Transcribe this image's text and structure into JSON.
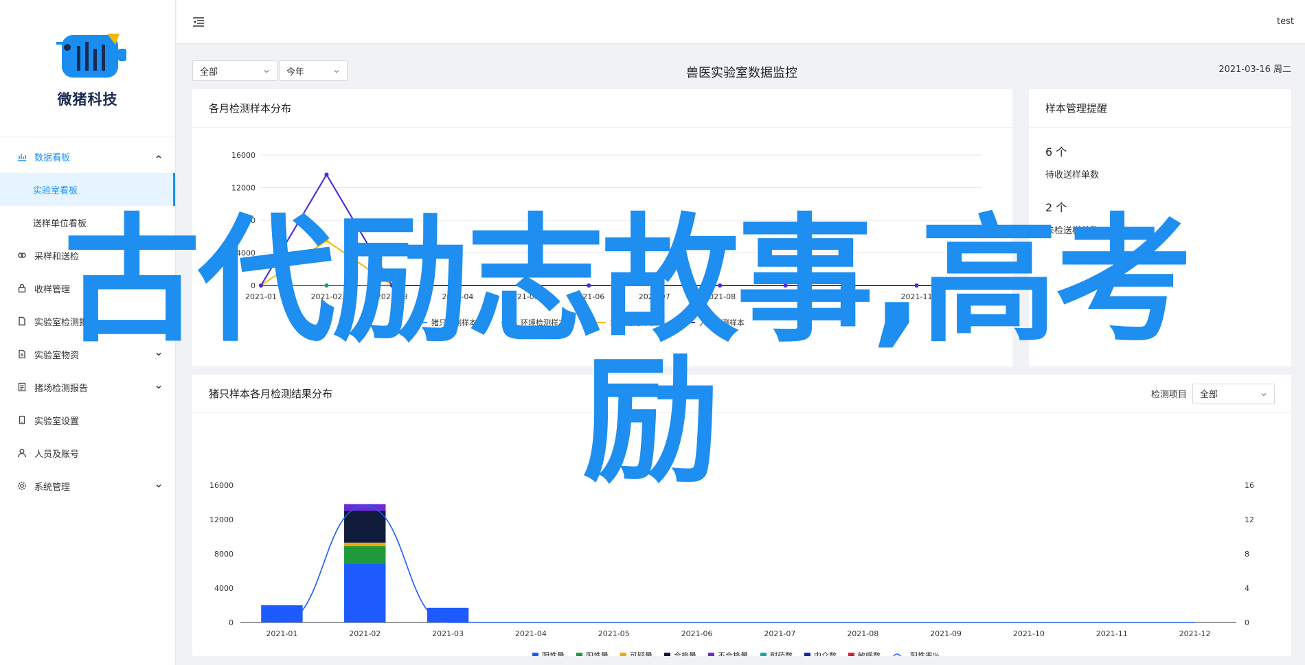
{
  "brand": {
    "name": "微猪科技"
  },
  "header": {
    "user": "test"
  },
  "sidebar": {
    "items": [
      {
        "label": "数据看板",
        "icon": "bar-chart-icon",
        "expanded": true
      },
      {
        "label": "实验室看板",
        "sub": true,
        "selected": true
      },
      {
        "label": "送样单位看板",
        "sub": true
      },
      {
        "label": "采样和送检",
        "icon": "link-icon"
      },
      {
        "label": "收样管理",
        "icon": "lock-icon"
      },
      {
        "label": "实验室检测报告",
        "icon": "file-icon",
        "chevron": true
      },
      {
        "label": "实验室物资",
        "icon": "file-text-icon",
        "chevron": true
      },
      {
        "label": "猪场检测报告",
        "icon": "report-icon",
        "chevron": true
      },
      {
        "label": "实验室设置",
        "icon": "device-icon"
      },
      {
        "label": "人员及账号",
        "icon": "user-icon"
      },
      {
        "label": "系统管理",
        "icon": "gear-icon",
        "chevron": true
      }
    ]
  },
  "toolbar": {
    "scope_select": "全部",
    "period_select": "今年",
    "title": "兽医实验室数据监控",
    "date": "2021-03-16 周二"
  },
  "card_monthly": {
    "title": "各月检测样本分布"
  },
  "card_reminder": {
    "title": "样本管理提醒",
    "items": [
      {
        "count": "6 个",
        "label": "待收送样单数"
      },
      {
        "count": "2 个",
        "label": "未检送样单数"
      }
    ]
  },
  "card_pig": {
    "title": "猪只样本各月检测结果分布",
    "filter_label": "检测项目",
    "filter_value": "全部"
  },
  "overlay": {
    "line1": "古代励志故事,高考",
    "line2": "励"
  },
  "colors": {
    "primary": "#1890ff",
    "overlay_text": "#1e8ef0",
    "series_pig": "#2f54eb",
    "series_env": "#13a35f",
    "series_vehicle": "#f5b800",
    "series_staff": "#7b2fd1"
  },
  "chart_data": [
    {
      "type": "line",
      "categories": [
        "2021-01",
        "2021-02",
        "2021-03",
        "2021-04",
        "2021-05",
        "2021-06",
        "2021-07",
        "2021-08",
        "2021-09",
        "2021-10",
        "2021-11",
        "2021-12"
      ],
      "ylim": [
        0,
        16000
      ],
      "yticks": [
        "0",
        "4000",
        "8000",
        "12000",
        "16000"
      ],
      "series": [
        {
          "name": "猪只检测样本",
          "color": "#1890ff",
          "values": [
            0,
            13600,
            0,
            0,
            0,
            0,
            0,
            0,
            0,
            0,
            0,
            0
          ]
        },
        {
          "name": "环境检测样本",
          "color": "#13a35f",
          "values": [
            0,
            0,
            0,
            0,
            0,
            0,
            0,
            0,
            0,
            0,
            0,
            0
          ]
        },
        {
          "name": "车辆检测样本",
          "color": "#f5b800",
          "values": [
            0,
            5500,
            0,
            0,
            0,
            0,
            0,
            0,
            0,
            0,
            0,
            0
          ]
        },
        {
          "name": "人员检测样本",
          "color": "#4b2bd9",
          "values": [
            0,
            13600,
            0,
            0,
            0,
            0,
            0,
            0,
            0,
            0,
            0,
            0
          ]
        }
      ],
      "legend_position": "bottom"
    },
    {
      "type": "bar",
      "stacked": true,
      "categories": [
        "2021-01",
        "2021-02",
        "2021-03",
        "2021-04",
        "2021-05",
        "2021-06",
        "2021-07",
        "2021-08",
        "2021-09",
        "2021-10",
        "2021-11",
        "2021-12"
      ],
      "ylim": [
        0,
        16000
      ],
      "yticks": [
        "0",
        "4000",
        "8000",
        "12000",
        "16000"
      ],
      "y2lim": [
        0,
        16
      ],
      "y2ticks": [
        "0",
        "4",
        "8",
        "12",
        "16"
      ],
      "series": [
        {
          "name": "阴性量",
          "color": "#1e5bff",
          "values": [
            2000,
            6900,
            1700,
            0,
            0,
            0,
            0,
            0,
            0,
            0,
            0,
            0
          ]
        },
        {
          "name": "阳性量",
          "color": "#1f9a3a",
          "values": [
            0,
            2000,
            0,
            0,
            0,
            0,
            0,
            0,
            0,
            0,
            0,
            0
          ]
        },
        {
          "name": "可疑量",
          "color": "#f0a800",
          "values": [
            0,
            400,
            0,
            0,
            0,
            0,
            0,
            0,
            0,
            0,
            0,
            0
          ]
        },
        {
          "name": "合格量",
          "color": "#101a3a",
          "values": [
            0,
            3700,
            0,
            0,
            0,
            0,
            0,
            0,
            0,
            0,
            0,
            0
          ]
        },
        {
          "name": "不合格量",
          "color": "#6a2bd1",
          "values": [
            0,
            800,
            0,
            0,
            0,
            0,
            0,
            0,
            0,
            0,
            0,
            0
          ]
        },
        {
          "name": "耐药数",
          "color": "#1aa3a3",
          "values": [
            0,
            0,
            0,
            0,
            0,
            0,
            0,
            0,
            0,
            0,
            0,
            0
          ]
        },
        {
          "name": "中介数",
          "color": "#1a22aa",
          "values": [
            0,
            0,
            0,
            0,
            0,
            0,
            0,
            0,
            0,
            0,
            0,
            0
          ]
        },
        {
          "name": "敏感数",
          "color": "#d2232a",
          "values": [
            0,
            0,
            0,
            0,
            0,
            0,
            0,
            0,
            0,
            0,
            0,
            0
          ]
        }
      ],
      "line_series": {
        "name": "阳性率%",
        "color": "#1e5bff",
        "values": [
          0,
          13.6,
          0,
          0,
          0,
          0,
          0,
          0,
          0,
          0,
          0,
          0
        ]
      },
      "legend_position": "bottom"
    }
  ]
}
